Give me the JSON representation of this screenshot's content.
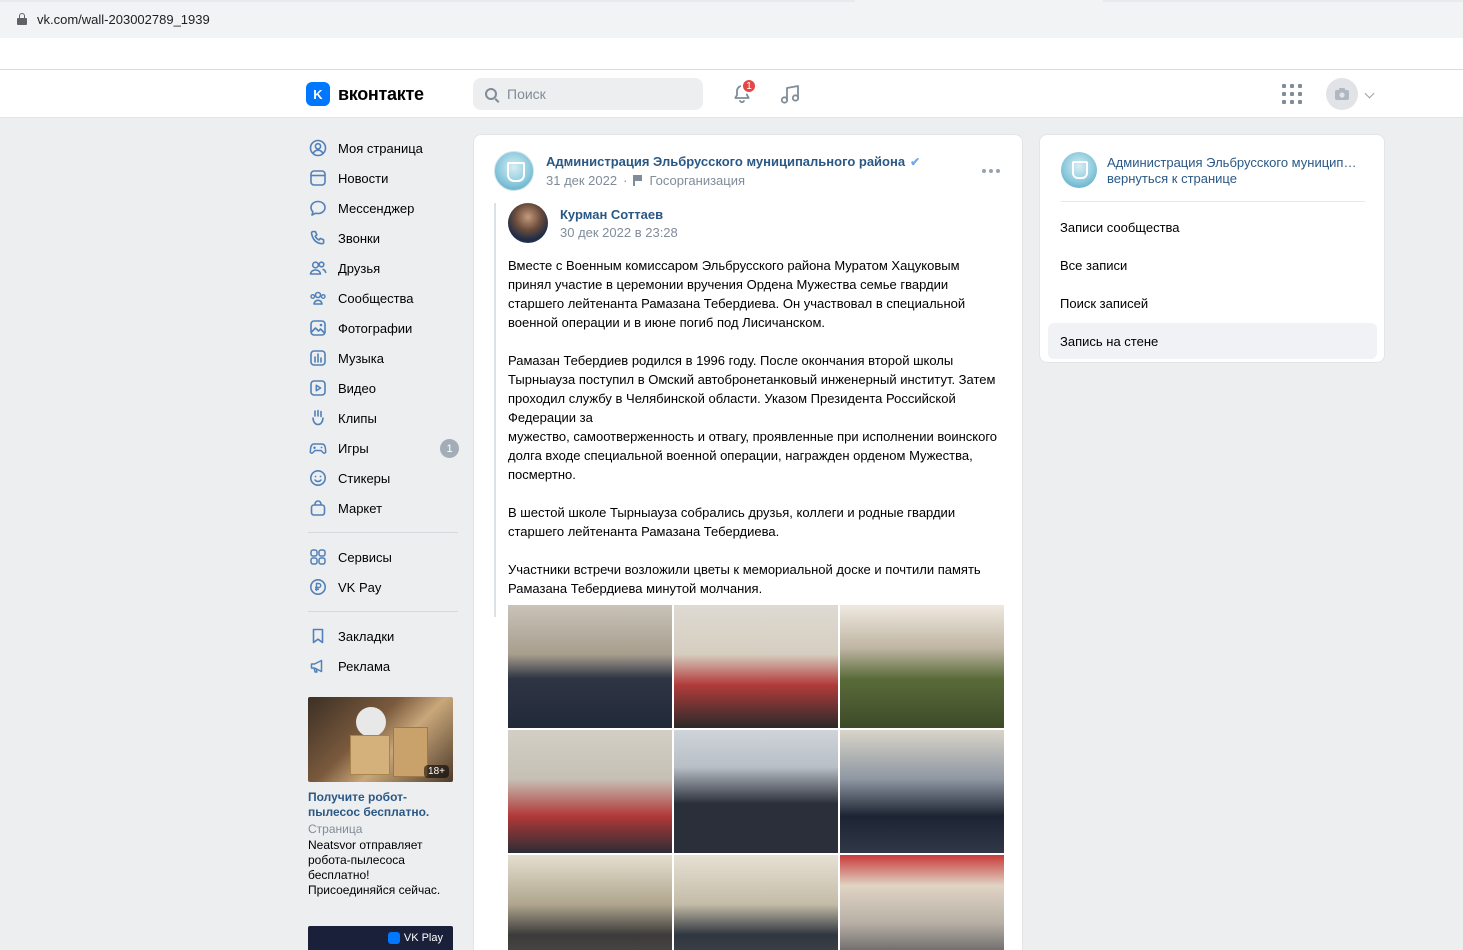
{
  "browser": {
    "url": "vk.com/wall-203002789_1939"
  },
  "header": {
    "logo_text": "вконтакте",
    "logo_mark": "K",
    "search_placeholder": "Поиск",
    "notifications_count": "1",
    "icons": [
      "bell-icon",
      "music-icon",
      "apps-grid-icon",
      "camera-avatar-icon",
      "chevron-down-icon"
    ]
  },
  "sidebar": {
    "items": [
      {
        "label": "Моя страница",
        "icon": "user-circle-icon"
      },
      {
        "label": "Новости",
        "icon": "news-icon"
      },
      {
        "label": "Мессенджер",
        "icon": "message-icon"
      },
      {
        "label": "Звонки",
        "icon": "phone-icon"
      },
      {
        "label": "Друзья",
        "icon": "friends-icon"
      },
      {
        "label": "Сообщества",
        "icon": "communities-icon"
      },
      {
        "label": "Фотографии",
        "icon": "photo-icon"
      },
      {
        "label": "Музыка",
        "icon": "music-icon"
      },
      {
        "label": "Видео",
        "icon": "video-icon"
      },
      {
        "label": "Клипы",
        "icon": "clips-icon"
      },
      {
        "label": "Игры",
        "icon": "gamepad-icon",
        "badge": "1"
      },
      {
        "label": "Стикеры",
        "icon": "sticker-icon"
      },
      {
        "label": "Маркет",
        "icon": "market-bag-icon"
      }
    ],
    "items2": [
      {
        "label": "Сервисы",
        "icon": "services-icon"
      },
      {
        "label": "VK Pay",
        "icon": "vkpay-icon"
      }
    ],
    "items3": [
      {
        "label": "Закладки",
        "icon": "bookmark-icon"
      },
      {
        "label": "Реклама",
        "icon": "megaphone-icon"
      }
    ],
    "ad": {
      "age": "18+",
      "title": "Получите робот-пылесос бесплатно.",
      "type": "Страница",
      "desc": "Neatsvor отправляет робота-пылесоса бесплатно! Присоединяйся сейчас."
    },
    "ad2": {
      "label": "VK Play"
    }
  },
  "post": {
    "group_name": "Администрация Эльбрусского муниципального района",
    "date": "31 дек 2022",
    "separator": "·",
    "category": "Госорганизация",
    "repost": {
      "author": "Курман Соттаев",
      "date": "30 дек 2022 в 23:28",
      "paragraphs": [
        "Вместе с Военным комиссаром Эльбрусского района Муратом Хацуковым принял участие в церемонии вручения Ордена Мужества семье гвардии старшего лейтенанта Рамазана Тебердиева. Он участвовал в специальной военной операции и в июне погиб под Лисичанском.",
        "Рамазан Тебердиев родился в 1996 году. После окончания второй школы Тырныауза поступил в Омский автобронетанковый инженерный институт. Затем проходил службу в Челябинской области. Указом Президента Российской Федерации за\nмужество, самоотверженность и отвагу, проявленные при исполнении воинского долга входе специальной военной операции, награжден орденом Мужества, посмертно.",
        "В шестой школе Тырныауза собрались друзья, коллеги и родные гвардии старшего лейтенанта Рамазана Тебердиева.",
        "Участники встречи возложили цветы к мемориальной доске и почтили память Рамазана Тебердиева минутой молчания."
      ]
    },
    "photos": [
      "photo-1",
      "photo-2",
      "photo-3",
      "photo-4",
      "photo-5",
      "photo-6",
      "photo-7",
      "photo-8",
      "photo-9"
    ]
  },
  "right_card": {
    "title": "Администрация Эльбрусского муниципального района",
    "back_link": "вернуться к странице",
    "menu": [
      {
        "label": "Записи сообщества",
        "active": false
      },
      {
        "label": "Все записи",
        "active": false
      },
      {
        "label": "Поиск записей",
        "active": false
      },
      {
        "label": "Запись на стене",
        "active": true
      }
    ]
  },
  "colors": {
    "brand": "#0077ff",
    "link": "#2a5885",
    "badge_red": "#e64646",
    "page_bg": "#edeef0"
  }
}
